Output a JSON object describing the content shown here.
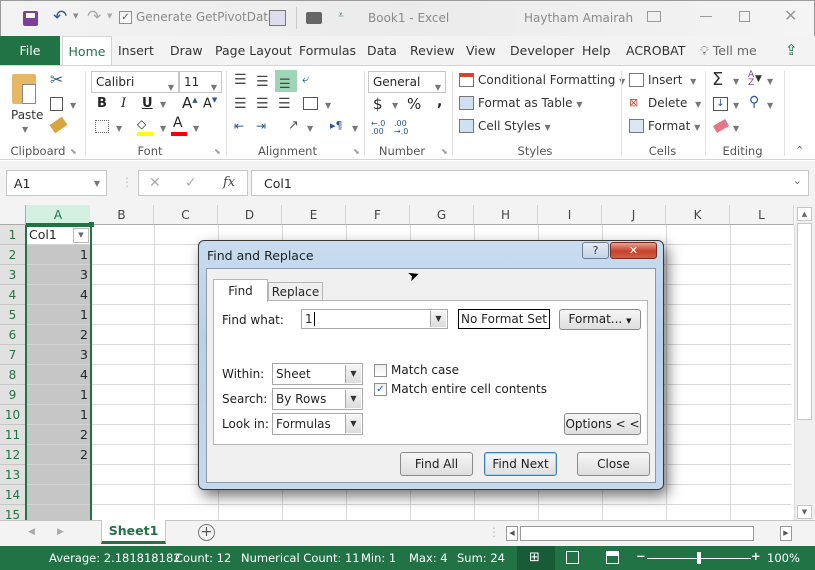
{
  "titlebar": {
    "qat_generate_label": "Generate GetPivotData",
    "document_title": "Book1  -  Excel",
    "user_name": "Haytham Amairah"
  },
  "ribbon_tabs": [
    "File",
    "Home",
    "Insert",
    "Draw",
    "Page Layout",
    "Formulas",
    "Data",
    "Review",
    "View",
    "Developer",
    "Help",
    "ACROBAT"
  ],
  "tell_me": "Tell me",
  "ribbon": {
    "clipboard": {
      "paste": "Paste",
      "label": "Clipboard"
    },
    "font": {
      "name": "Calibri",
      "size": "11",
      "label": "Font",
      "bold": "B",
      "italic": "I",
      "underline": "U",
      "fill_color": "#ffff00",
      "font_color": "#ff0000"
    },
    "alignment": {
      "label": "Alignment"
    },
    "number": {
      "format": "General",
      "label": "Number",
      "currency": "$",
      "percent": "%",
      "comma": ","
    },
    "styles": {
      "conditional": "Conditional Formatting",
      "format_table": "Format as Table",
      "cell_styles": "Cell Styles",
      "label": "Styles"
    },
    "cells": {
      "insert": "Insert",
      "delete": "Delete",
      "format": "Format",
      "label": "Cells"
    },
    "editing": {
      "label": "Editing"
    }
  },
  "formula_bar": {
    "name_box": "A1",
    "fx": "fx",
    "content": "Col1"
  },
  "grid": {
    "columns": [
      "A",
      "B",
      "C",
      "D",
      "E",
      "F",
      "G",
      "H",
      "I",
      "J",
      "K",
      "L"
    ],
    "rows": [
      "1",
      "2",
      "3",
      "4",
      "5",
      "6",
      "7",
      "8",
      "9",
      "10",
      "11",
      "12",
      "13",
      "14",
      "15"
    ],
    "colA": [
      "Col1",
      "1",
      "3",
      "4",
      "1",
      "2",
      "3",
      "4",
      "1",
      "1",
      "2",
      "2",
      "",
      "",
      ""
    ]
  },
  "sheet_tab": "Sheet1",
  "status": {
    "average": "Average: 2.181818182",
    "count": "Count: 12",
    "numerical_count": "Numerical Count: 11",
    "min": "Min: 1",
    "max": "Max: 4",
    "sum": "Sum: 24",
    "zoom": "100%",
    "zoom_level_pct": 100
  },
  "dialog": {
    "title": "Find and Replace",
    "help": "?",
    "tab_find": "Find",
    "tab_replace": "Replace",
    "find_what_label": "Find what:",
    "find_what_value": "1",
    "no_format": "No Format Set",
    "format_btn": "Format...",
    "within_label": "Within:",
    "within_value": "Sheet",
    "search_label": "Search:",
    "search_value": "By Rows",
    "lookin_label": "Look in:",
    "lookin_value": "Formulas",
    "match_case": "Match case",
    "match_case_checked": false,
    "match_entire": "Match entire cell contents",
    "match_entire_checked": true,
    "options_btn": "Options < <",
    "find_all": "Find All",
    "find_next": "Find Next",
    "close": "Close"
  }
}
